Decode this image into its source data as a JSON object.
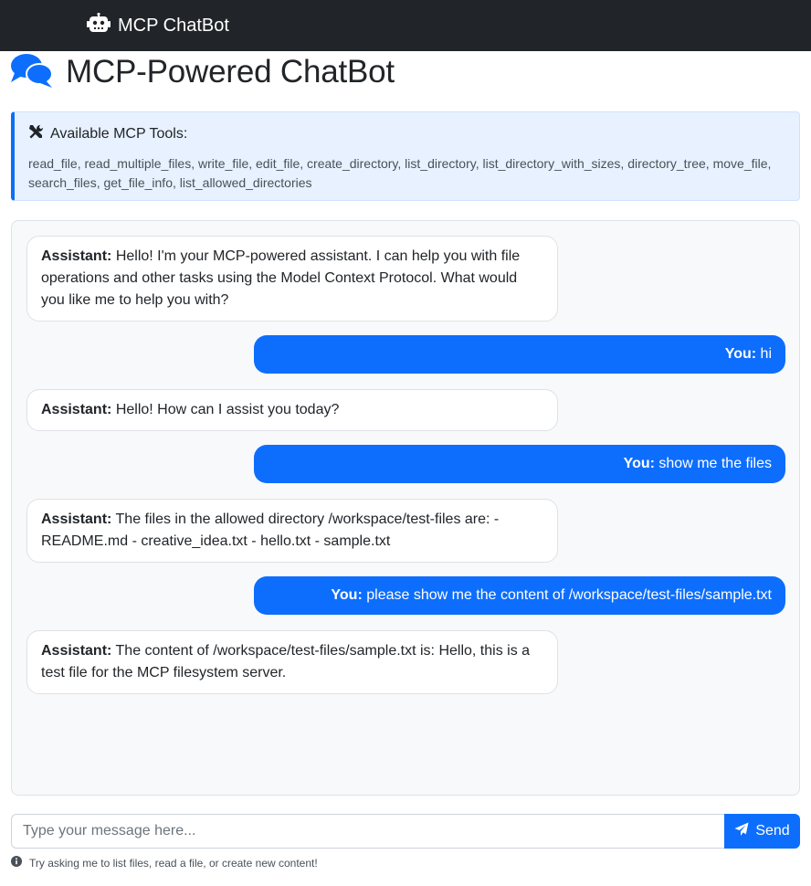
{
  "navbar": {
    "brand": "MCP ChatBot",
    "icon": "robot-icon"
  },
  "header": {
    "title": "MCP-Powered ChatBot",
    "icon": "comments-icon"
  },
  "tools": {
    "heading": "Available MCP Tools:",
    "icon": "tools-icon",
    "list": "read_file, read_multiple_files, write_file, edit_file, create_directory, list_directory, list_directory_with_sizes, directory_tree, move_file, search_files, get_file_info, list_allowed_directories"
  },
  "messages": [
    {
      "role": "assistant",
      "sender": "Assistant:",
      "text": "Hello! I'm your MCP-powered assistant. I can help you with file operations and other tasks using the Model Context Protocol. What would you like me to help you with?"
    },
    {
      "role": "user",
      "sender": "You:",
      "text": "hi"
    },
    {
      "role": "assistant",
      "sender": "Assistant:",
      "text": "Hello! How can I assist you today?"
    },
    {
      "role": "user",
      "sender": "You:",
      "text": "show me the files"
    },
    {
      "role": "assistant",
      "sender": "Assistant:",
      "text": "The files in the allowed directory /workspace/test-files are: - README.md - creative_idea.txt - hello.txt - sample.txt"
    },
    {
      "role": "user",
      "sender": "You:",
      "text": "please show me the content of /workspace/test-files/sample.txt"
    },
    {
      "role": "assistant",
      "sender": "Assistant:",
      "text": "The content of /workspace/test-files/sample.txt is: Hello, this is a test file for the MCP filesystem server."
    }
  ],
  "composer": {
    "placeholder": "Type your message here...",
    "value": "",
    "send_label": "Send",
    "send_icon": "paper-plane-icon"
  },
  "hint": {
    "icon": "info-icon",
    "text": "Try asking me to list files, read a file, or create new content!"
  },
  "colors": {
    "navbar": "#212529",
    "accent": "#0d6efd",
    "tools_bg": "#e7f1ff",
    "chat_bg": "#f8f9fa"
  }
}
